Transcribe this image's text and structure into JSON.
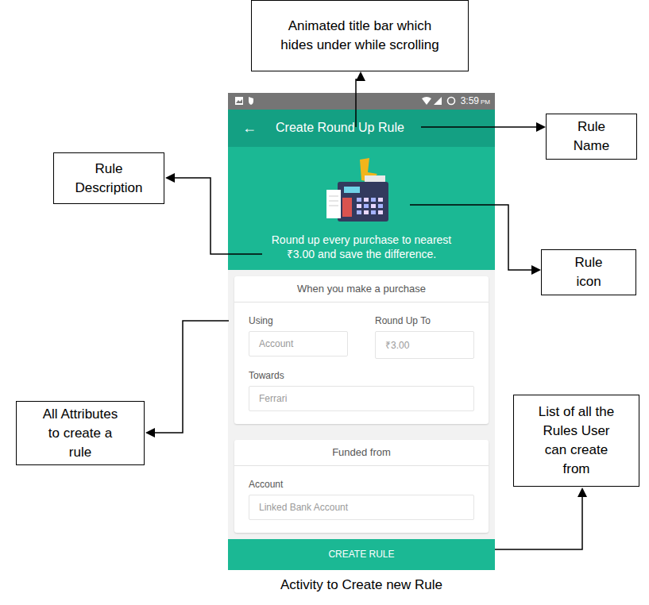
{
  "annotations": [
    {
      "text": "Animated title bar which hides under while scrolling"
    },
    {
      "text": "Rule Name"
    },
    {
      "text": "Rule Description"
    },
    {
      "text": "Rule icon"
    },
    {
      "text": "All Attributes to create a rule"
    },
    {
      "text": "List of all the Rules User can create from"
    }
  ],
  "status_bar": {
    "time": "3:59",
    "period": "PM"
  },
  "app_bar": {
    "back": "←",
    "title": "Create Round Up Rule"
  },
  "hero": {
    "description": "Round up every purchase to nearest ₹3.00 and save the difference."
  },
  "sections": [
    {
      "title": "When you make a purchase",
      "fields": [
        {
          "label": "Using",
          "placeholder": "Account"
        },
        {
          "label": "Round Up To",
          "placeholder": "₹3.00"
        },
        {
          "label": "Towards",
          "placeholder": "Ferrari"
        }
      ]
    },
    {
      "title": "Funded from",
      "fields": [
        {
          "label": "Account",
          "placeholder": "Linked Bank Account"
        }
      ]
    }
  ],
  "button": "CREATE RULE",
  "caption": "Activity to Create new Rule"
}
